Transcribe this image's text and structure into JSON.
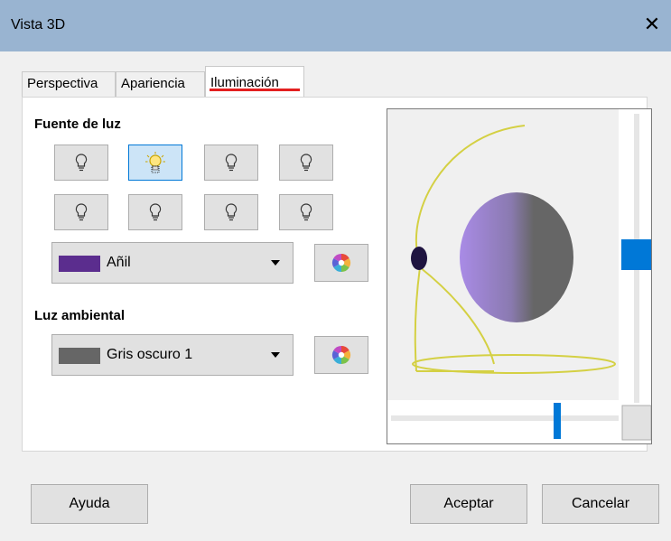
{
  "window": {
    "title": "Vista 3D",
    "close_glyph": "✕"
  },
  "tabs": [
    {
      "label": "Perspectiva"
    },
    {
      "label": "Apariencia"
    },
    {
      "label": "Iluminación",
      "active": true
    }
  ],
  "light_source": {
    "label": "Fuente de luz",
    "buttons": [
      {
        "name": "light-1",
        "selected": false
      },
      {
        "name": "light-2",
        "selected": true
      },
      {
        "name": "light-3",
        "selected": false
      },
      {
        "name": "light-4",
        "selected": false
      },
      {
        "name": "light-5",
        "selected": false
      },
      {
        "name": "light-6",
        "selected": false
      },
      {
        "name": "light-7",
        "selected": false
      },
      {
        "name": "light-8",
        "selected": false
      }
    ],
    "color_value": "Añil",
    "color_swatch": "#5b2d8e"
  },
  "ambient": {
    "label": "Luz ambiental",
    "color_value": "Gris oscuro 1",
    "color_swatch": "#666666"
  },
  "buttons": {
    "help": "Ayuda",
    "ok": "Aceptar",
    "cancel": "Cancelar"
  }
}
